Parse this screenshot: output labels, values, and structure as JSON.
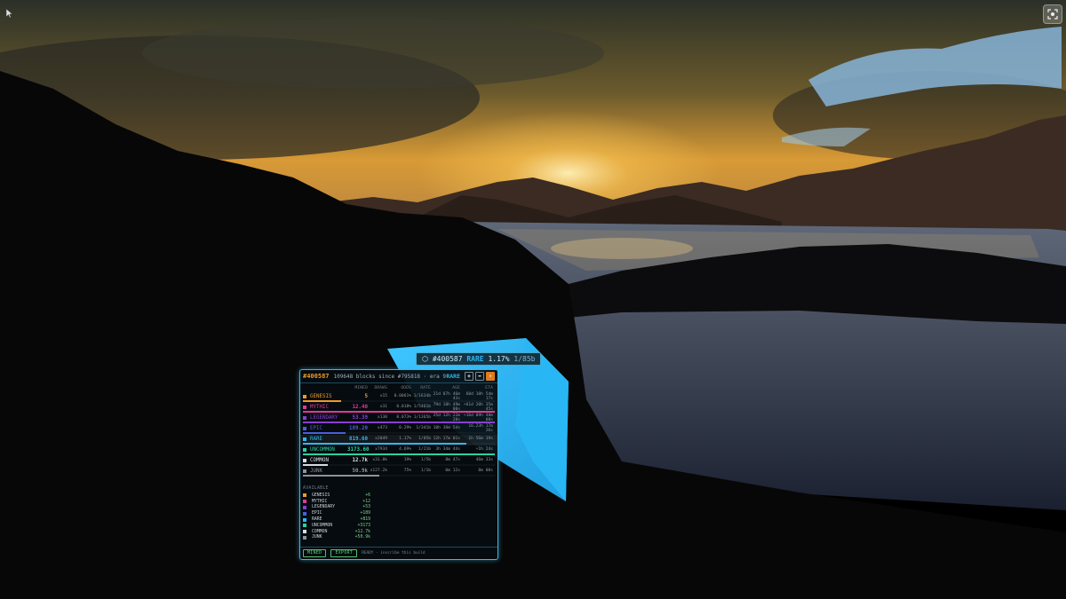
{
  "block_label": {
    "id": "#400587",
    "rarity": "RARE",
    "percent": "1.17%",
    "fraction": "1/85b"
  },
  "panel": {
    "block_number": "#400587",
    "since_text": "109648 blocks since #795818 · era 9",
    "rarity": "RARE",
    "columns": {
      "mined": "MINED",
      "drops": "DRAWS",
      "odds": "ODDS",
      "rate": "RATE",
      "age": "AGE",
      "eta": "ETA"
    },
    "rows": [
      {
        "name": "GENESIS",
        "color": "#f0992a",
        "mined": "5",
        "drops": "x15",
        "odds": "0.0061%",
        "rate": "1/1634b",
        "age": "21d 07h 46m 43s",
        "eta": "60d 10h 54m 17s",
        "bar": 0.2
      },
      {
        "name": "MYTHIC",
        "color": "#e0399a",
        "mined": "12.40",
        "drops": "x31",
        "odds": "0.018%",
        "rate": "1/5461b",
        "age": "79d 18h 49m 08s",
        "eta": "+61d 20h 35m 45s",
        "bar": 1.0
      },
      {
        "name": "LEGENDARY",
        "color": "#8a3fd0",
        "mined": "53.39",
        "drops": "x130",
        "odds": "0.073%",
        "rate": "1/1365b",
        "age": "25d 12h 22m 28s",
        "eta": "+16d 09h 48m 08s",
        "bar": 1.0
      },
      {
        "name": "EPIC",
        "color": "#4a5fe0",
        "mined": "189.20",
        "drops": "x473",
        "odds": "0.29%",
        "rate": "1/341b",
        "age": "10h 38m 54s",
        "eta": "16.23h 17m 26s",
        "bar": 0.22
      },
      {
        "name": "RARE",
        "color": "#2fb6ee",
        "mined": "819.60",
        "drops": "x2049",
        "odds": "1.17%",
        "rate": "1/85b",
        "age": "12h 17m 01s",
        "eta": "1h 56m 19s",
        "bar": 0.85
      },
      {
        "name": "UNCOMMON",
        "color": "#2bd3a0",
        "mined": "3173.60",
        "drops": "x7934",
        "odds": "4.69%",
        "rate": "1/21b",
        "age": "3h 34m 44s",
        "eta": "+1h 24s",
        "bar": 1.0
      },
      {
        "name": "COMMON",
        "color": "#d8dcde",
        "mined": "12.7k",
        "drops": "x31.8k",
        "odds": "19%",
        "rate": "1/5b",
        "age": "8m 47s",
        "eta": "46m 33s",
        "bar": 0.13
      },
      {
        "name": "JUNK",
        "color": "#8d9396",
        "mined": "50.9k",
        "drops": "x127.2k",
        "odds": "75%",
        "rate": "1/1b",
        "age": "0m 12s",
        "eta": "8m 08s",
        "bar": 0.4
      }
    ],
    "available_title": "AVAILABLE",
    "available": [
      {
        "name": "GENESIS",
        "color": "#f0992a",
        "value": "+6"
      },
      {
        "name": "MYTHIC",
        "color": "#e0399a",
        "value": "+12"
      },
      {
        "name": "LEGENDARY",
        "color": "#8a3fd0",
        "value": "+53"
      },
      {
        "name": "EPIC",
        "color": "#4a5fe0",
        "value": "+189"
      },
      {
        "name": "RARE",
        "color": "#2fb6ee",
        "value": "+819"
      },
      {
        "name": "UNCOMMON",
        "color": "#2bd3a0",
        "value": "+3173"
      },
      {
        "name": "COMMON",
        "color": "#d8dcde",
        "value": "+12.7k"
      },
      {
        "name": "JUNK",
        "color": "#8d9396",
        "value": "+50.9k"
      }
    ],
    "footer": {
      "mined_label": "MINED",
      "export_label": "EXPORT",
      "status": "READY · inscribe this build"
    }
  },
  "icons": {
    "corner": "fullscreen-icon",
    "pointer": "cursor-icon"
  }
}
